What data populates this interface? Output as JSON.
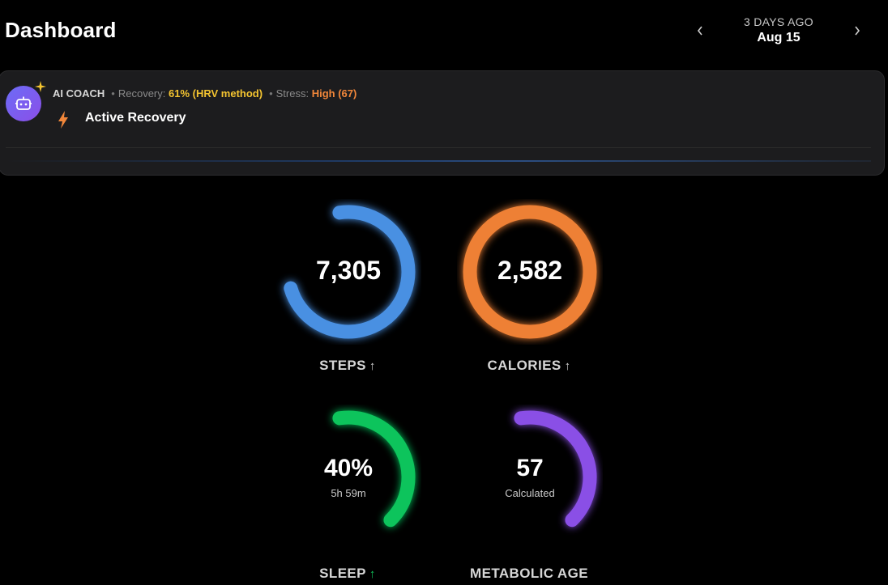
{
  "header": {
    "title": "Dashboard",
    "date_relative": "3 DAYS AGO",
    "date": "Aug 15",
    "prev_icon": "chevron-left-icon",
    "next_icon": "chevron-right-icon"
  },
  "coach": {
    "name": "AI COACH",
    "recovery_label": "Recovery:",
    "recovery_value": "61% (HRV method)",
    "stress_label": "Stress:",
    "stress_value": "High (67)",
    "message": "Active Recovery",
    "avatar_icon": "robot-icon",
    "sparkle_icon": "sparkle-icon",
    "message_icon": "lightning-icon",
    "colors": {
      "recovery": "#f4c430",
      "stress": "#f2873a"
    }
  },
  "metrics": [
    {
      "id": "steps",
      "value": "7,305",
      "sub": "",
      "label": "STEPS",
      "trend": "↑",
      "progress": 0.73,
      "color": "#4a90e2"
    },
    {
      "id": "calories",
      "value": "2,582",
      "sub": "",
      "label": "CALORIES",
      "trend": "↑",
      "progress": 1.0,
      "color": "#ee8034"
    },
    {
      "id": "sleep",
      "value": "40%",
      "sub": "5h 59m",
      "label": "SLEEP",
      "trend": "↑",
      "progress": 0.4,
      "color": "#10c45c"
    },
    {
      "id": "metabolic",
      "value": "57",
      "sub": "Calculated",
      "label": "METABOLIC AGE",
      "trend": "",
      "progress": 0.4,
      "color": "#8a4fe6"
    }
  ]
}
